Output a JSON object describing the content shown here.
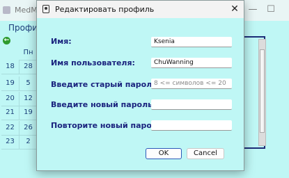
{
  "background": {
    "title": "MedMa",
    "menu_label": "Профиль",
    "window_controls": {
      "minimize": "—",
      "maximize": "☐"
    },
    "table_header": "Пн",
    "left_column": [
      "18",
      "19",
      "20",
      "21",
      "22",
      "23"
    ],
    "right_column": [
      "28",
      "5",
      "12",
      "19",
      "26",
      "2"
    ],
    "icons": {
      "back": "back-arrow-icon",
      "app": "app-icon"
    }
  },
  "dialog": {
    "title": "Редактировать профиль",
    "close_glyph": "✕",
    "fields": {
      "name": {
        "label": "Имя:",
        "value": "Ksenia"
      },
      "username": {
        "label": "Имя пользователя:",
        "value": "ChuWanning"
      },
      "old_password": {
        "label": "Введите старый пароль:",
        "placeholder": "8 <= символов <= 20"
      },
      "new_password": {
        "label": "Введите новый пароль:",
        "value": ""
      },
      "repeat_password": {
        "label": "Повторите новый пароль:",
        "value": ""
      }
    },
    "buttons": {
      "ok": "OK",
      "cancel": "Cancel"
    }
  },
  "colors": {
    "window_bg": "#bff7f5",
    "label_text": "#1a237e",
    "accent": "#2b5ab8"
  }
}
